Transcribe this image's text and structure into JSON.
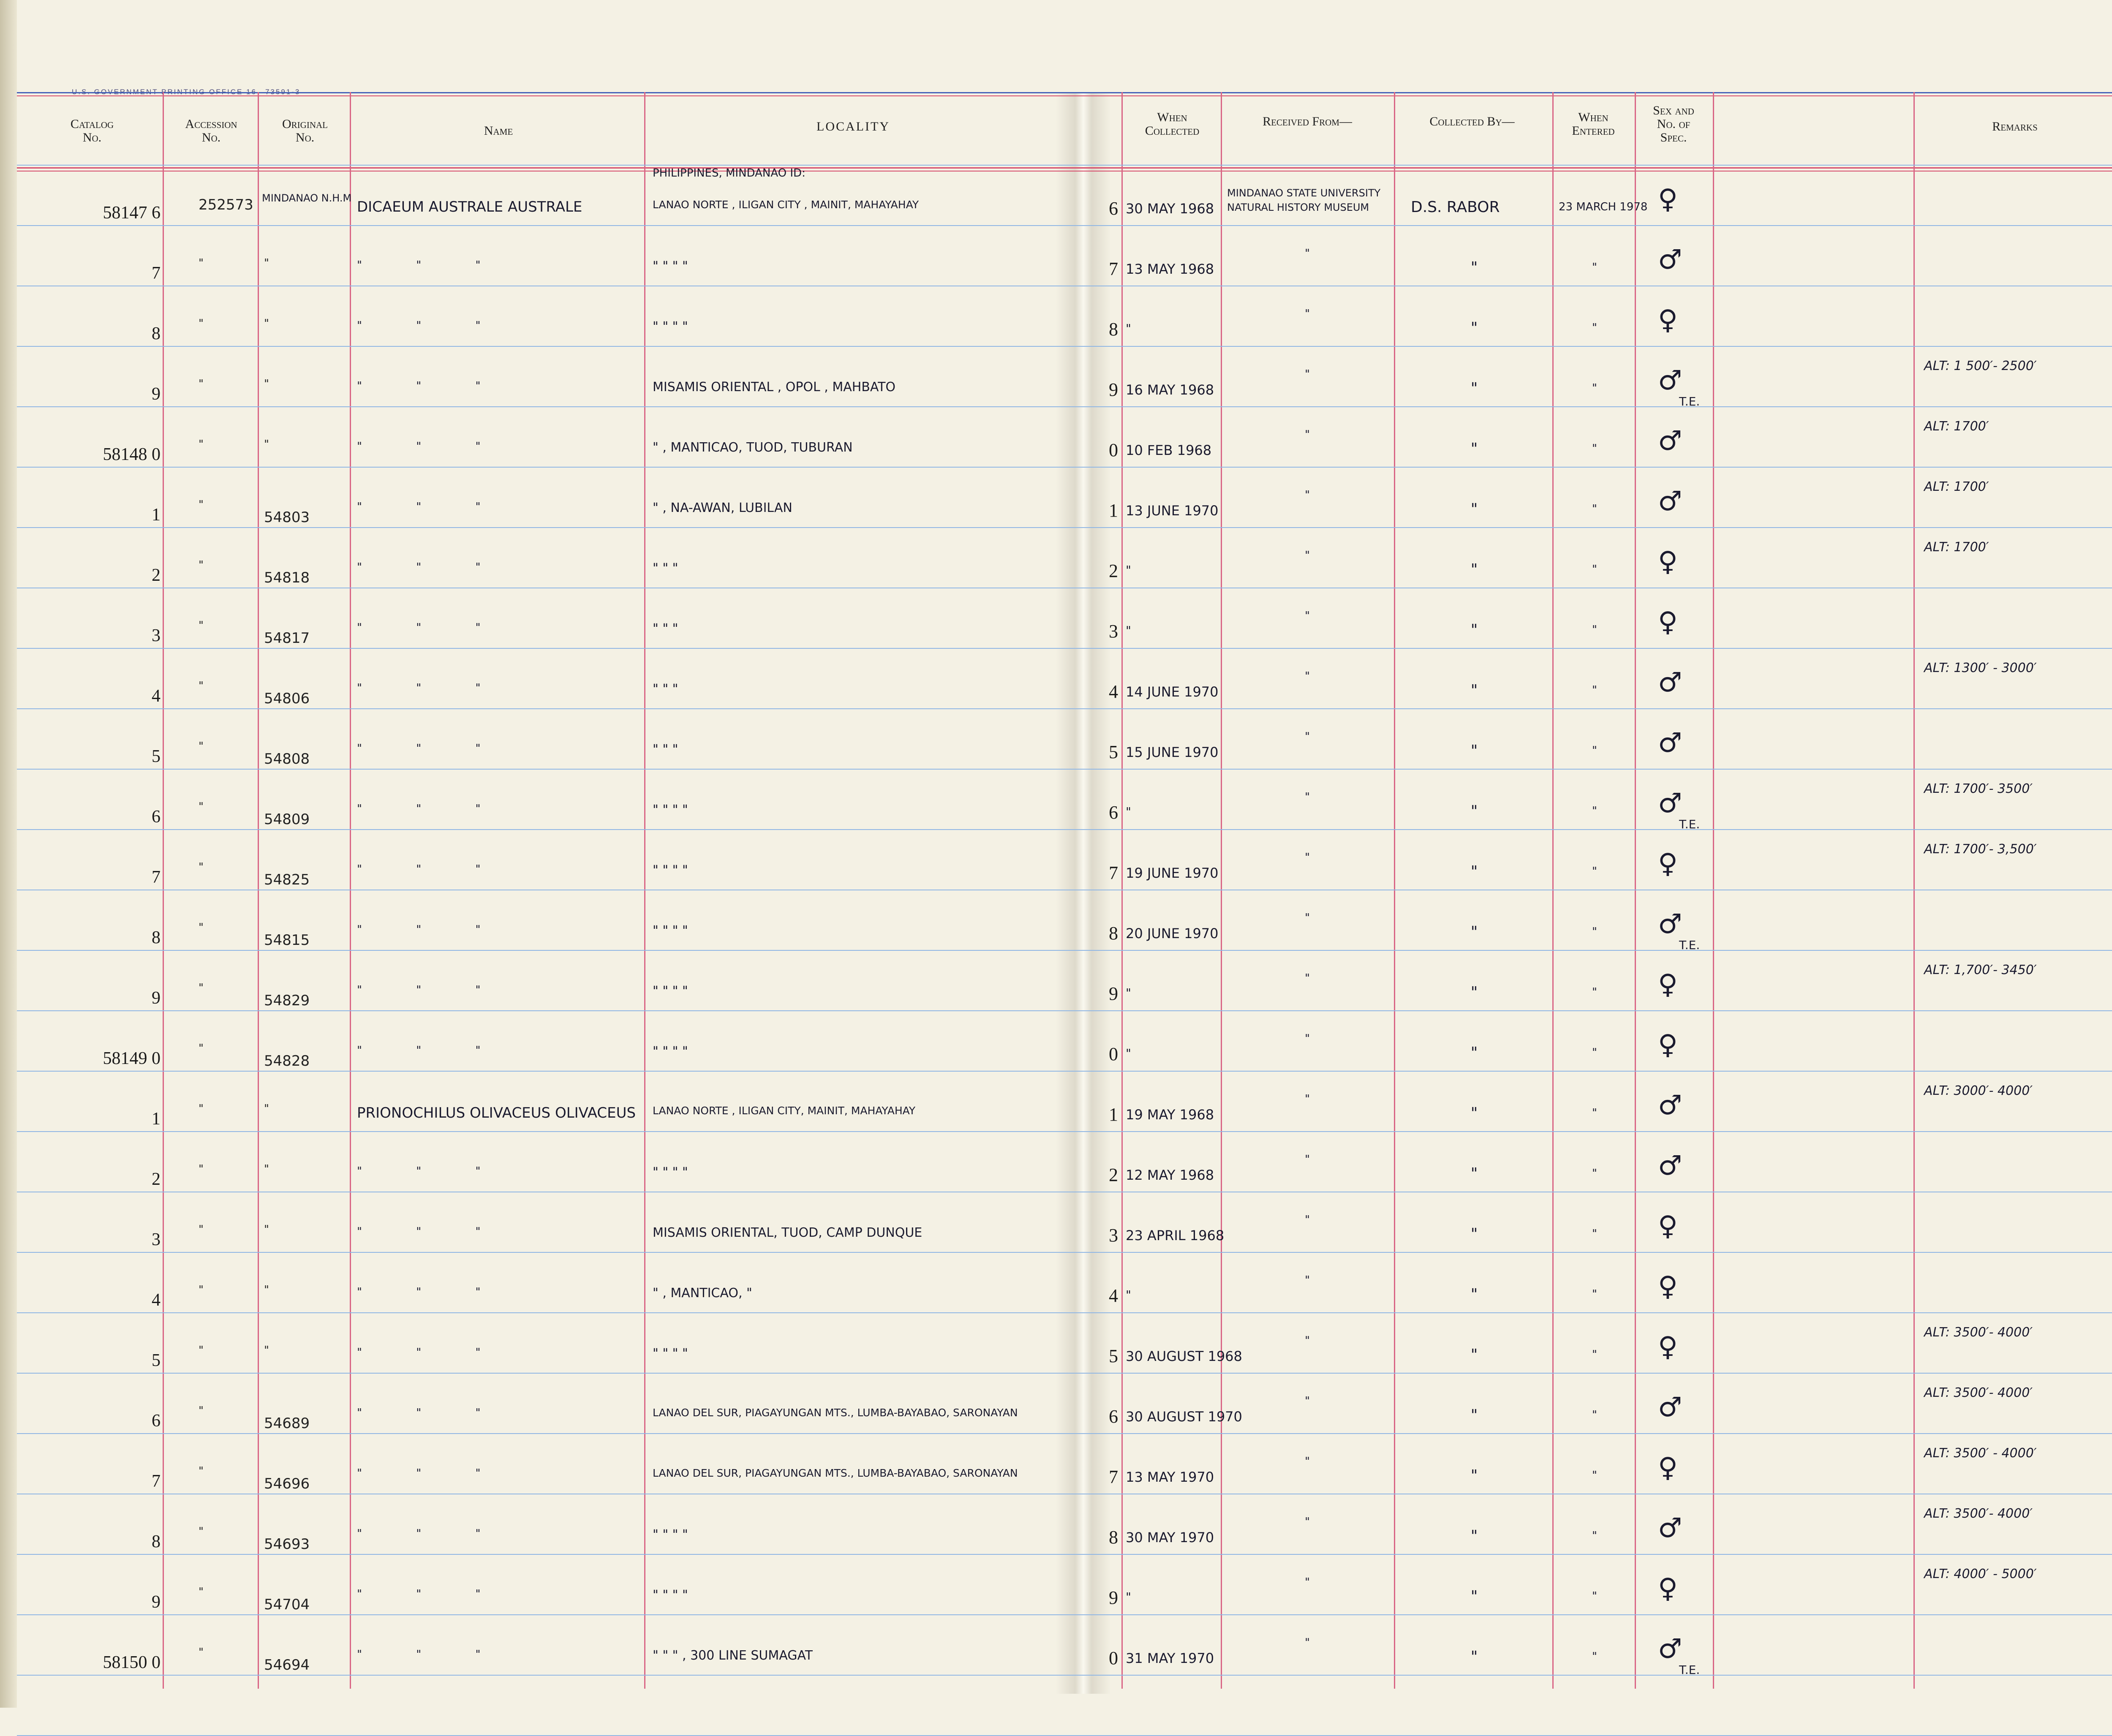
{
  "ledger": {
    "printer_line": "U.S. GOVERNMENT PRINTING OFFICE    16—73591-3",
    "headers": {
      "catalog": "Catalog\nNo.",
      "accession": "Accession\nNo.",
      "original": "Original\nNo.",
      "name": "Name",
      "locality": "LOCALITY",
      "when_collected": "When\nCollected",
      "received_from": "Received From—",
      "collected_by": "Collected By—",
      "when_entered": "When\nEntered",
      "sex": "Sex and\nNo. of\nSpec.",
      "remarks": "Remarks"
    },
    "top_notes": {
      "original_header": "MINDANAO N.H.M",
      "locality_header": "PHILIPPINES, MINDANAO ID:"
    },
    "rows": [
      {
        "catalog": "58147 6",
        "accession": "252573",
        "original": "",
        "name": "DICAEUM AUSTRALE  AUSTRALE",
        "locality": "LANAO NORTE , ILIGAN CITY , MAINIT, MAHAYAHAY",
        "day": "6",
        "date": "30 MAY 1968",
        "received": "MINDANAO STATE UNIVERSITY NATURAL HISTORY MUSEUM",
        "collector": "D.S. RABOR",
        "entered": "23 MARCH 1978",
        "sex": "♀",
        "te": "",
        "remark": ""
      },
      {
        "catalog": "7",
        "accession": "\"",
        "original": "\"",
        "name": "\"   \"   \"",
        "locality": "\"   \"   \"   \"",
        "day": "7",
        "date": "13 MAY 1968",
        "received": "\"",
        "collector": "\"",
        "entered": "\"",
        "sex": "♂",
        "te": "",
        "remark": ""
      },
      {
        "catalog": "8",
        "accession": "\"",
        "original": "\"",
        "name": "\"   \"   \"",
        "locality": "\"   \"   \"   \"",
        "day": "8",
        "date": "\"",
        "received": "\"",
        "collector": "\"",
        "entered": "\"",
        "sex": "♀",
        "te": "",
        "remark": ""
      },
      {
        "catalog": "9",
        "accession": "\"",
        "original": "\"",
        "name": "\"   \"   \"",
        "locality": "MISAMIS ORIENTAL , OPOL , MAHBATO",
        "day": "9",
        "date": "16 MAY 1968",
        "received": "\"",
        "collector": "\"",
        "entered": "\"",
        "sex": "♂",
        "te": "T.E.",
        "remark": "ALT: 1 500′- 2500′"
      },
      {
        "catalog": "58148 0",
        "accession": "\"",
        "original": "\"",
        "name": "\"   \"   \"",
        "locality": "\"   , MANTICAO, TUOD, TUBURAN",
        "day": "0",
        "date": "10 FEB 1968",
        "received": "\"",
        "collector": "\"",
        "entered": "\"",
        "sex": "♂",
        "te": "",
        "remark": "ALT: 1700′"
      },
      {
        "catalog": "1",
        "accession": "\"",
        "original": "54803",
        "name": "\"   \"   \"",
        "locality": "\"   , NA-AWAN, LUBILAN",
        "day": "1",
        "date": "13 JUNE 1970",
        "received": "\"",
        "collector": "\"",
        "entered": "\"",
        "sex": "♂",
        "te": "",
        "remark": "ALT: 1700′"
      },
      {
        "catalog": "2",
        "accession": "\"",
        "original": "54818",
        "name": "\"   \"   \"",
        "locality": "\"   \"   \"",
        "day": "2",
        "date": "\"",
        "received": "\"",
        "collector": "\"",
        "entered": "\"",
        "sex": "♀",
        "te": "",
        "remark": "ALT: 1700′"
      },
      {
        "catalog": "3",
        "accession": "\"",
        "original": "54817",
        "name": "\"   \"   \"",
        "locality": "\"   \"   \"",
        "day": "3",
        "date": "\"",
        "received": "\"",
        "collector": "\"",
        "entered": "\"",
        "sex": "♀",
        "te": "",
        "remark": ""
      },
      {
        "catalog": "4",
        "accession": "\"",
        "original": "54806",
        "name": "\"   \"   \"",
        "locality": "\"   \"   \"",
        "day": "4",
        "date": "14 JUNE 1970",
        "received": "\"",
        "collector": "\"",
        "entered": "\"",
        "sex": "♂",
        "te": "",
        "remark": "ALT: 1300′ - 3000′"
      },
      {
        "catalog": "5",
        "accession": "\"",
        "original": "54808",
        "name": "\"   \"   \"",
        "locality": "\"   \"   \"",
        "day": "5",
        "date": "15 JUNE 1970",
        "received": "\"",
        "collector": "\"",
        "entered": "\"",
        "sex": "♂",
        "te": "",
        "remark": ""
      },
      {
        "catalog": "6",
        "accession": "\"",
        "original": "54809",
        "name": "\"   \"   \"",
        "locality": "\"   \"   \"   \"",
        "day": "6",
        "date": "\"",
        "received": "\"",
        "collector": "\"",
        "entered": "\"",
        "sex": "♂",
        "te": "T.E.",
        "remark": "ALT: 1700′- 3500′"
      },
      {
        "catalog": "7",
        "accession": "\"",
        "original": "54825",
        "name": "\"   \"   \"",
        "locality": "\"   \"   \"   \"",
        "day": "7",
        "date": "19 JUNE 1970",
        "received": "\"",
        "collector": "\"",
        "entered": "\"",
        "sex": "♀",
        "te": "",
        "remark": "ALT: 1700′- 3,500′"
      },
      {
        "catalog": "8",
        "accession": "\"",
        "original": "54815",
        "name": "\"   \"   \"",
        "locality": "\"   \"   \"   \"",
        "day": "8",
        "date": "20 JUNE 1970",
        "received": "\"",
        "collector": "\"",
        "entered": "\"",
        "sex": "♂",
        "te": "T.E.",
        "remark": ""
      },
      {
        "catalog": "9",
        "accession": "\"",
        "original": "54829",
        "name": "\"   \"   \"",
        "locality": "\"   \"   \"   \"",
        "day": "9",
        "date": "\"",
        "received": "\"",
        "collector": "\"",
        "entered": "\"",
        "sex": "♀",
        "te": "",
        "remark": "ALT: 1,700′- 3450′"
      },
      {
        "catalog": "58149 0",
        "accession": "\"",
        "original": "54828",
        "name": "\"   \"   \"",
        "locality": "\"   \"   \"   \"",
        "day": "0",
        "date": "\"",
        "received": "\"",
        "collector": "\"",
        "entered": "\"",
        "sex": "♀",
        "te": "",
        "remark": ""
      },
      {
        "catalog": "1",
        "accession": "\"",
        "original": "\"",
        "name": "PRIONOCHILUS OLIVACEUS  OLIVACEUS",
        "locality": "LANAO NORTE , ILIGAN CITY, MAINIT, MAHAYAHAY",
        "day": "1",
        "date": "19 MAY 1968",
        "received": "\"",
        "collector": "\"",
        "entered": "\"",
        "sex": "♂",
        "te": "",
        "remark": "ALT: 3000′- 4000′"
      },
      {
        "catalog": "2",
        "accession": "\"",
        "original": "\"",
        "name": "\"   \"   \"",
        "locality": "\"   \"   \"   \"",
        "day": "2",
        "date": "12 MAY 1968",
        "received": "\"",
        "collector": "\"",
        "entered": "\"",
        "sex": "♂",
        "te": "",
        "remark": ""
      },
      {
        "catalog": "3",
        "accession": "\"",
        "original": "\"",
        "name": "\"   \"   \"",
        "locality": "MISAMIS ORIENTAL, TUOD, CAMP DUNQUE",
        "day": "3",
        "date": "23 APRIL 1968",
        "received": "\"",
        "collector": "\"",
        "entered": "\"",
        "sex": "♀",
        "te": "",
        "remark": ""
      },
      {
        "catalog": "4",
        "accession": "\"",
        "original": "\"",
        "name": "\"   \"   \"",
        "locality": "\"  , MANTICAO, \"",
        "day": "4",
        "date": "\"",
        "received": "\"",
        "collector": "\"",
        "entered": "\"",
        "sex": "♀",
        "te": "",
        "remark": ""
      },
      {
        "catalog": "5",
        "accession": "\"",
        "original": "\"",
        "name": "\"   \"   \"",
        "locality": "\"   \"   \"   \"",
        "day": "5",
        "date": "30 AUGUST 1968",
        "received": "\"",
        "collector": "\"",
        "entered": "\"",
        "sex": "♀",
        "te": "",
        "remark": "ALT: 3500′- 4000′"
      },
      {
        "catalog": "6",
        "accession": "\"",
        "original": "54689",
        "name": "\"   \"   \"",
        "locality": "LANAO DEL SUR, PIAGAYUNGAN MTS., LUMBA-BAYABAO, SARONAYAN",
        "day": "6",
        "date": "30 AUGUST 1970",
        "received": "\"",
        "collector": "\"",
        "entered": "\"",
        "sex": "♂",
        "te": "",
        "remark": "ALT: 3500′- 4000′"
      },
      {
        "catalog": "7",
        "accession": "\"",
        "original": "54696",
        "name": "\"   \"   \"",
        "locality": "LANAO DEL SUR, PIAGAYUNGAN MTS., LUMBA-BAYABAO, SARONAYAN",
        "day": "7",
        "date": "13 MAY 1970",
        "received": "\"",
        "collector": "\"",
        "entered": "\"",
        "sex": "♀",
        "te": "",
        "remark": "ALT: 3500′ - 4000′"
      },
      {
        "catalog": "8",
        "accession": "\"",
        "original": "54693",
        "name": "\"   \"   \"",
        "locality": "\"   \"   \"   \"",
        "day": "8",
        "date": "30 MAY 1970",
        "received": "\"",
        "collector": "\"",
        "entered": "\"",
        "sex": "♂",
        "te": "",
        "remark": "ALT: 3500′- 4000′"
      },
      {
        "catalog": "9",
        "accession": "\"",
        "original": "54704",
        "name": "\"   \"   \"",
        "locality": "\"   \"   \"   \"",
        "day": "9",
        "date": "\"",
        "received": "\"",
        "collector": "\"",
        "entered": "\"",
        "sex": "♀",
        "te": "",
        "remark": "ALT: 4000′ - 5000′"
      },
      {
        "catalog": "58150 0",
        "accession": "\"",
        "original": "54694",
        "name": "\"   \"   \"",
        "locality": "\"   \"   \"  , 300 LINE SUMAGAT",
        "day": "0",
        "date": "31 MAY 1970",
        "received": "\"",
        "collector": "\"",
        "entered": "\"",
        "sex": "♂",
        "te": "T.E.",
        "remark": ""
      }
    ]
  },
  "colors": {
    "paper": "#f4f1e4",
    "rule_blue": "#8fb6e4",
    "rule_red": "#d96585",
    "ink": "#1a1a2e"
  }
}
